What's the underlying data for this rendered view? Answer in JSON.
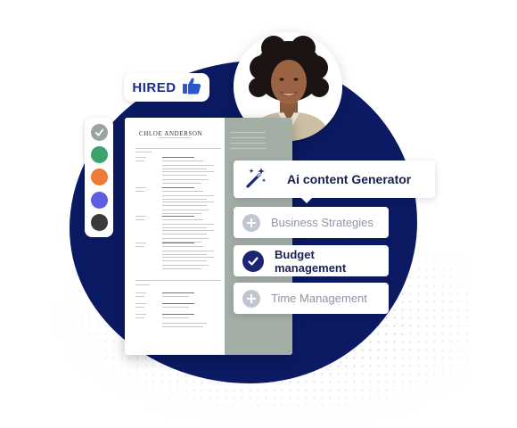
{
  "badge": {
    "text": "HIRED",
    "icon": "thumbs-up-icon"
  },
  "resume": {
    "name": "CHLOE ANDERSON"
  },
  "palette": {
    "colors": [
      "#9aa39c",
      "#3aa36e",
      "#ee7a36",
      "#5b5fe0",
      "#3a3a3a"
    ],
    "selected_index": 0
  },
  "ai_card": {
    "label": "Ai content Generator",
    "icon": "magic-wand-icon"
  },
  "options": [
    {
      "label": "Business Strategies",
      "state": "unselected"
    },
    {
      "label": "Budget management",
      "state": "selected"
    },
    {
      "label": "Time Management",
      "state": "unselected"
    }
  ],
  "colors": {
    "brand_navy": "#0b1a63",
    "check_navy": "#1b2573",
    "muted": "#8e96a6"
  }
}
